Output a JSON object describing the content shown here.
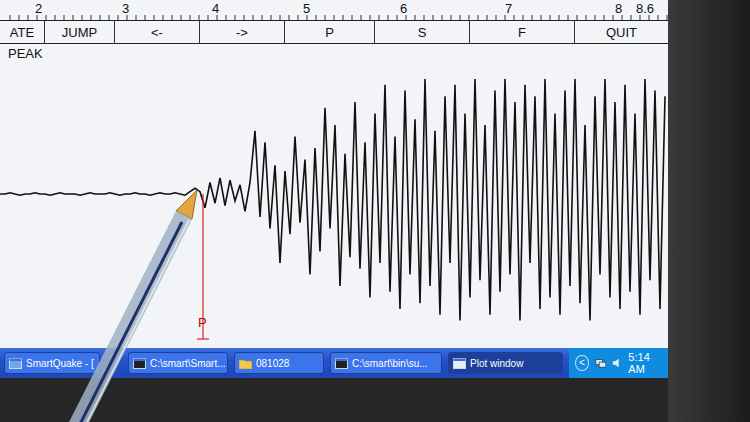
{
  "ruler": {
    "ticks": [
      "2",
      "3",
      "4",
      "5",
      "6",
      "7",
      "8",
      "8.6"
    ]
  },
  "toolbar": {
    "buttons": [
      {
        "label": "ATE"
      },
      {
        "label": "JUMP"
      },
      {
        "label": "<-"
      },
      {
        "label": "->"
      },
      {
        "label": "P"
      },
      {
        "label": "S"
      },
      {
        "label": "F"
      },
      {
        "label": "QUIT"
      }
    ]
  },
  "mode": "PEAK",
  "plot": {
    "series": [
      {
        "values": [
          0,
          0,
          0.01,
          0,
          -0.01,
          0,
          0,
          0.01,
          0,
          0,
          -0.01,
          0,
          0.01,
          0,
          0,
          0,
          -0.01,
          0,
          0.01,
          0,
          0,
          0,
          0.01,
          0,
          -0.01,
          0,
          0,
          0.01,
          0,
          0,
          -0.01,
          0,
          0.01,
          0,
          0,
          0.01,
          0,
          -0.01,
          0.02,
          0.05,
          0.02,
          -0.12,
          0.1,
          -0.08,
          0.14,
          -0.1,
          0.12,
          -0.06,
          0.08,
          -0.15,
          0.1,
          0.55,
          -0.2,
          0.45,
          -0.3,
          0.25,
          -0.6,
          0.2,
          -0.35,
          0.5,
          -0.25,
          0.3,
          -0.7,
          0.4,
          -0.5,
          0.75,
          -0.3,
          0.6,
          -0.8,
          0.35,
          -0.55,
          0.8,
          -0.65,
          0.45,
          -0.9,
          0.7,
          -0.6,
          0.95,
          -0.85,
          0.5,
          -1.0,
          0.9,
          -0.7,
          0.65,
          -0.95,
          1.0,
          -0.8,
          0.55,
          -1.05,
          0.85,
          -0.6,
          0.95,
          -1.1,
          0.7,
          -0.9,
          1.0,
          -0.75,
          0.6,
          -1.05,
          0.9,
          -0.85,
          1.0,
          -0.7,
          0.8,
          -1.1,
          0.95,
          -0.6,
          0.85,
          -1.0,
          1.0,
          -0.9,
          0.7,
          -1.05,
          0.9,
          -0.8,
          1.0,
          -0.95,
          0.6,
          -1.1,
          0.85,
          -0.7,
          1.0,
          -0.9,
          0.8,
          -1.0,
          0.95,
          -0.85,
          0.7,
          -1.05,
          1.0,
          -0.75,
          0.9,
          -1.0,
          0.85
        ]
      }
    ],
    "markers": [
      {
        "label": "P",
        "at": 40
      }
    ]
  },
  "taskbar": {
    "items": [
      {
        "label": "SmartQuake - [",
        "selected": false
      },
      {
        "label": "C:\\smart\\Smart...",
        "selected": false
      },
      {
        "label": "081028",
        "selected": false
      },
      {
        "label": "C:\\smart\\bin\\su...",
        "selected": false
      },
      {
        "label": "Plot window",
        "selected": true
      }
    ],
    "tray": {
      "expand": "<",
      "clock": "5:14 AM"
    }
  }
}
